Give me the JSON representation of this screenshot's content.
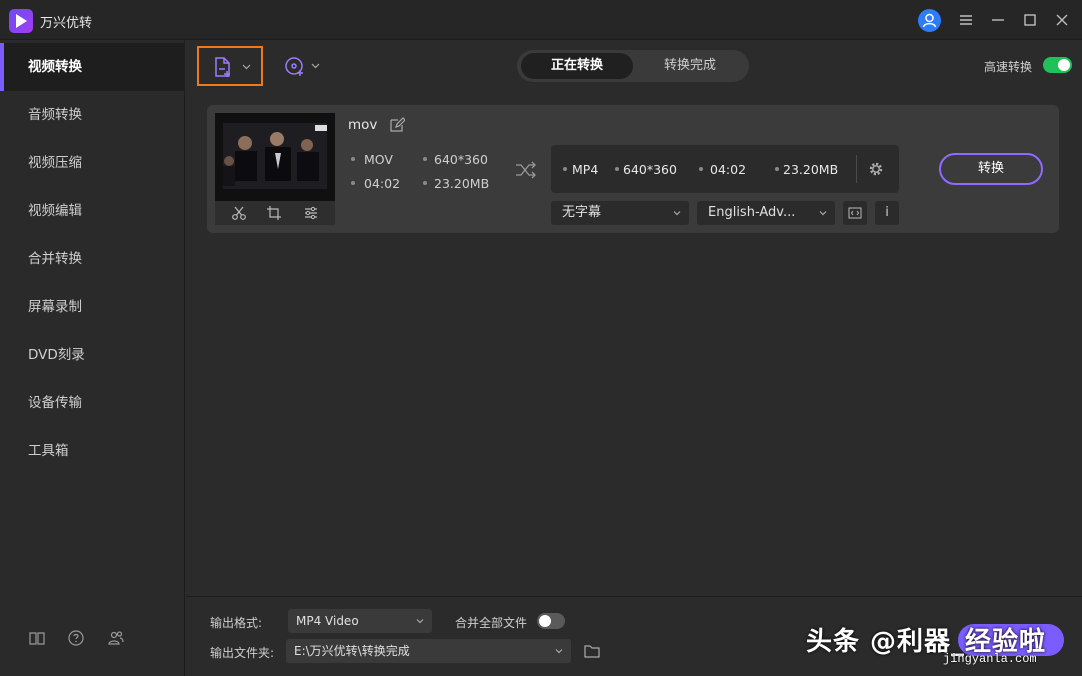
{
  "app": {
    "title": "万兴优转"
  },
  "sidebar": {
    "items": [
      {
        "label": "视频转换"
      },
      {
        "label": "音频转换"
      },
      {
        "label": "视频压缩"
      },
      {
        "label": "视频编辑"
      },
      {
        "label": "合并转换"
      },
      {
        "label": "屏幕录制"
      },
      {
        "label": "DVD刻录"
      },
      {
        "label": "设备传输"
      },
      {
        "label": "工具箱"
      }
    ]
  },
  "toolbar": {
    "tabs": [
      {
        "label": "正在转换"
      },
      {
        "label": "转换完成"
      }
    ],
    "speed_label": "高速转换"
  },
  "file": {
    "name": "mov",
    "source": {
      "format": "MOV",
      "duration": "04:02",
      "resolution": "640*360",
      "size": "23.20MB"
    },
    "output": {
      "format": "MP4",
      "resolution": "640*360",
      "duration": "04:02",
      "size": "23.20MB"
    },
    "subtitle": "无字幕",
    "audio": "English-Adv...",
    "convert_label": "转换",
    "info_label": "i"
  },
  "bottom": {
    "format_label": "输出格式:",
    "format_value": "MP4 Video",
    "merge_label": "合并全部文件",
    "folder_label": "输出文件夹:",
    "folder_value": "E:\\万兴优转\\转换完成"
  },
  "watermark": {
    "text": "头条 @利器_经验啦",
    "url": "jingyanla.com"
  },
  "colors": {
    "accent": "#7b5cff",
    "highlight_border": "#f07a1a",
    "toggle_on": "#21c15a"
  }
}
